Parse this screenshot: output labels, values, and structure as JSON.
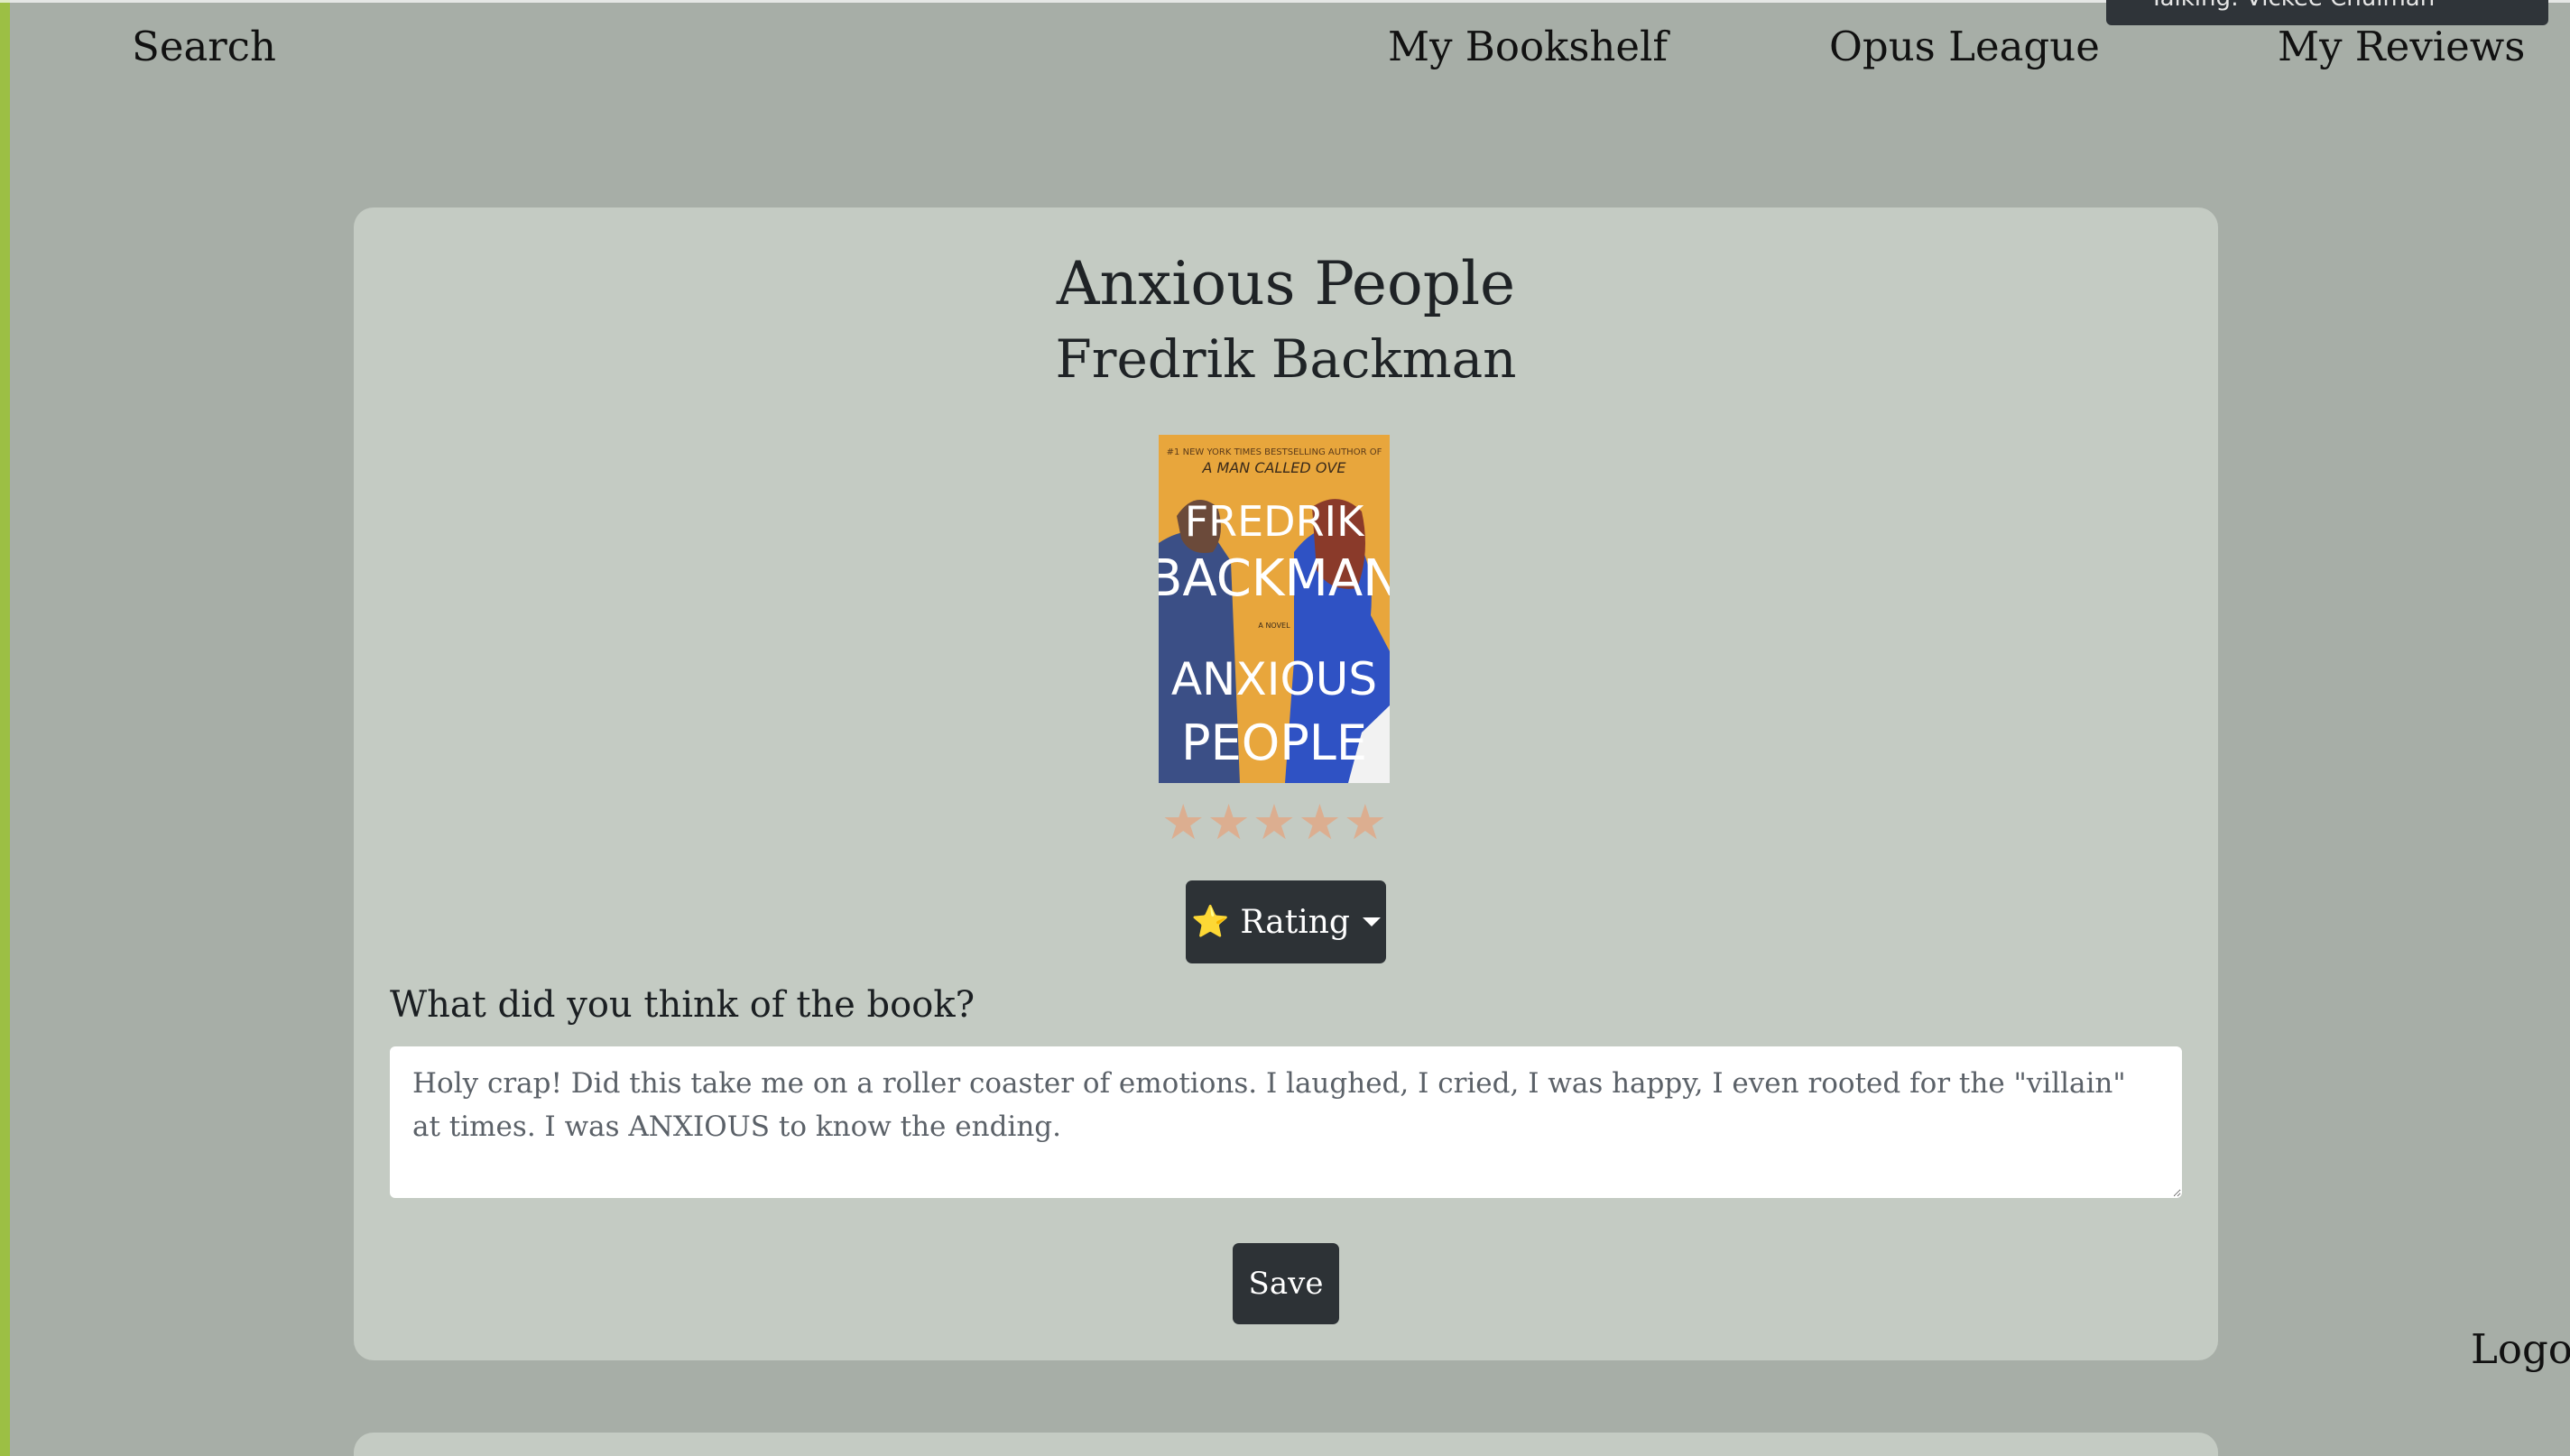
{
  "nav": {
    "search": "Search",
    "bookshelf": "My Bookshelf",
    "league": "Opus League",
    "reviews": "My Reviews",
    "logout": "Logou"
  },
  "toast": {
    "text": "Talking: Vickee Chulman"
  },
  "book": {
    "title": "Anxious People",
    "author": "Fredrik Backman",
    "cover": {
      "tagline_top": "#1 NEW YORK TIMES BESTSELLING AUTHOR OF",
      "tagline_book": "A MAN CALLED OVE",
      "author_line1": "FREDRIK",
      "author_line2": "BACKMAN",
      "novel": "A NOVEL",
      "title_line1": "ANXIOUS",
      "title_line2": "PEOPLE"
    },
    "stars": [
      "★",
      "★",
      "★",
      "★",
      "★"
    ]
  },
  "rating": {
    "icon": "⭐",
    "label": "Rating"
  },
  "review": {
    "question": "What did you think of the book?",
    "text": "Holy crap! Did this take me on a roller coaster of emotions. I laughed, I cried, I was happy, I even rooted for the \"villain\" at times. I was ANXIOUS to know the ending."
  },
  "save": {
    "label": "Save"
  },
  "colors": {
    "background": "#a7aea7",
    "card": "#c4cbc3",
    "accent": "#9cbf44",
    "button": "#2d3236",
    "star": "#dcae90"
  }
}
